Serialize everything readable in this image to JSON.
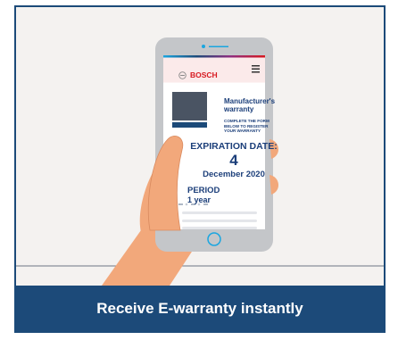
{
  "brand": {
    "name": "BOSCH"
  },
  "warranty": {
    "title": "Manufacturer's warranty",
    "subtitle": "COMPLETE THE FORM BELOW TO REGISTER YOUR WARRANTY"
  },
  "expiration": {
    "label": "EXPIRATION DATE:",
    "day": "4",
    "month_year": "December 2020"
  },
  "period": {
    "label": "PERIOD",
    "value": "1 year"
  },
  "caption": "Receive E-warranty instantly",
  "colors": {
    "brand_red": "#d71920",
    "navy": "#1c4a79",
    "text_blue": "#1c3f7a",
    "skin": "#f2a87b",
    "phone_frame": "#c4c6c9"
  }
}
